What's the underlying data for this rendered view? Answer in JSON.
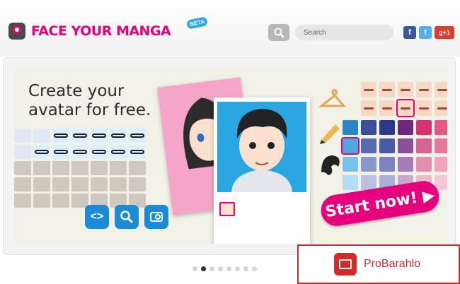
{
  "header": {
    "logo_text": "FACE YOUR MANGA",
    "beta_badge": "BETA",
    "search": {
      "placeholder": "Search"
    },
    "social": {
      "facebook": "f",
      "twitter": "t",
      "google": "g+1"
    }
  },
  "banner": {
    "headline_line1": "Create your",
    "headline_line2": "avatar for free.",
    "start_button": "Start now! ▶"
  },
  "carousel": {
    "active_index": 1,
    "count": 8
  },
  "watermark": {
    "text": "ProBarahlo"
  }
}
